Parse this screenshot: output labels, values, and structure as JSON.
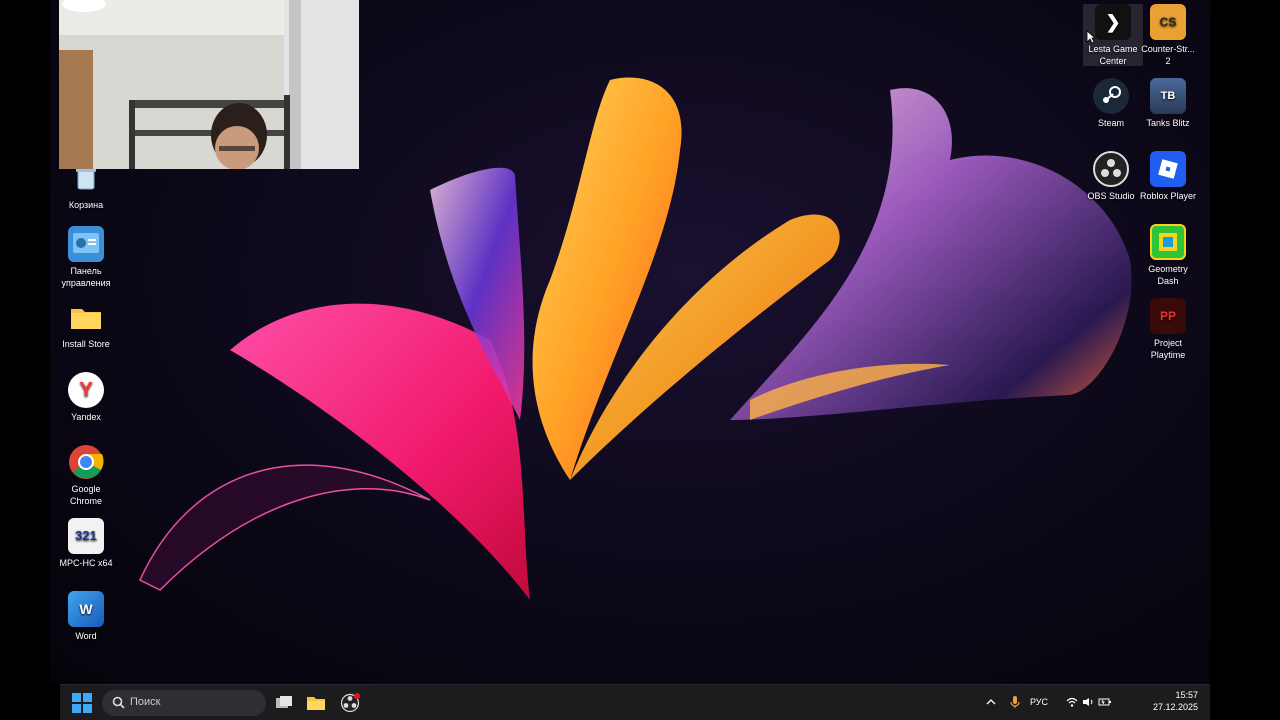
{
  "desktop": {
    "left_icons": [
      {
        "label": "Корзина",
        "icon": "recycle-bin-icon"
      },
      {
        "label": "Панель управления",
        "icon": "control-panel-icon"
      },
      {
        "label": "Install Store",
        "icon": "folder-icon"
      },
      {
        "label": "Yandex",
        "icon": "yandex-icon"
      },
      {
        "label": "Google Chrome",
        "icon": "chrome-icon"
      },
      {
        "label": "MPC-HC x64",
        "icon": "mpc-hc-icon"
      },
      {
        "label": "Word",
        "icon": "word-icon"
      }
    ],
    "right_icons": [
      {
        "label": "Lesta Game Center",
        "icon": "lesta-game-center-icon",
        "selected": true
      },
      {
        "label": "Counter-Str... 2",
        "icon": "counter-strike-icon"
      },
      {
        "label": "Steam",
        "icon": "steam-icon"
      },
      {
        "label": "Tanks Blitz",
        "icon": "tanks-blitz-icon"
      },
      {
        "label": "OBS Studio",
        "icon": "obs-studio-icon"
      },
      {
        "label": "Roblox Player",
        "icon": "roblox-icon"
      },
      {
        "label": "Geometry Dash",
        "icon": "geometry-dash-icon"
      },
      {
        "label": "Project Playtime",
        "icon": "project-playtime-icon"
      }
    ]
  },
  "taskbar": {
    "search_placeholder": "Поиск",
    "apps": [
      "task-view-icon",
      "file-explorer-icon",
      "obs-studio-icon"
    ],
    "tray": {
      "language": "РУС",
      "time": "15:57",
      "date": "27.12.2025"
    }
  },
  "colors": {
    "taskbar": "#1c1c1e",
    "accent": "#3fa9f5"
  }
}
